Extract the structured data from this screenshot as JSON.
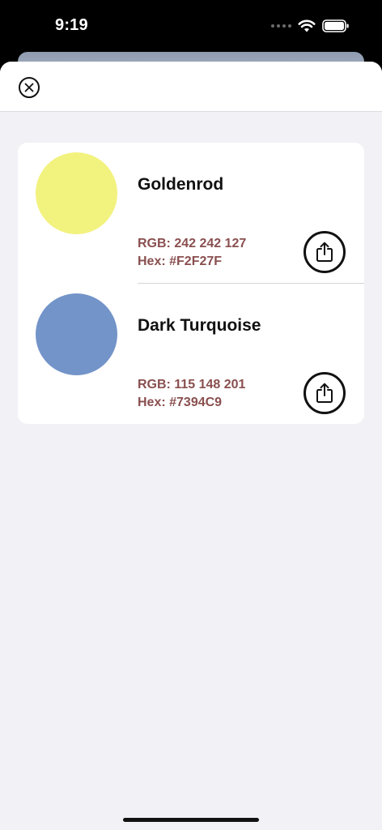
{
  "status_bar": {
    "time": "9:19",
    "icons": [
      "signal-dots-icon",
      "wifi-icon",
      "battery-icon"
    ]
  },
  "sheet": {
    "close_icon": "close-circle-icon"
  },
  "colors": [
    {
      "name": "Goldenrod",
      "rgb_label": "RGB: 242 242 127",
      "hex_label": "Hex: #F2F27F",
      "swatch": "#F2F27F",
      "share_icon": "share-icon"
    },
    {
      "name": "Dark Turquoise",
      "rgb_label": "RGB: 115 148 201",
      "hex_label": "Hex: #7394C9",
      "swatch": "#7394C9",
      "share_icon": "share-icon"
    }
  ],
  "theme": {
    "value_text_color": "#8A4F4F",
    "sheet_background": "#F2F1F6"
  }
}
